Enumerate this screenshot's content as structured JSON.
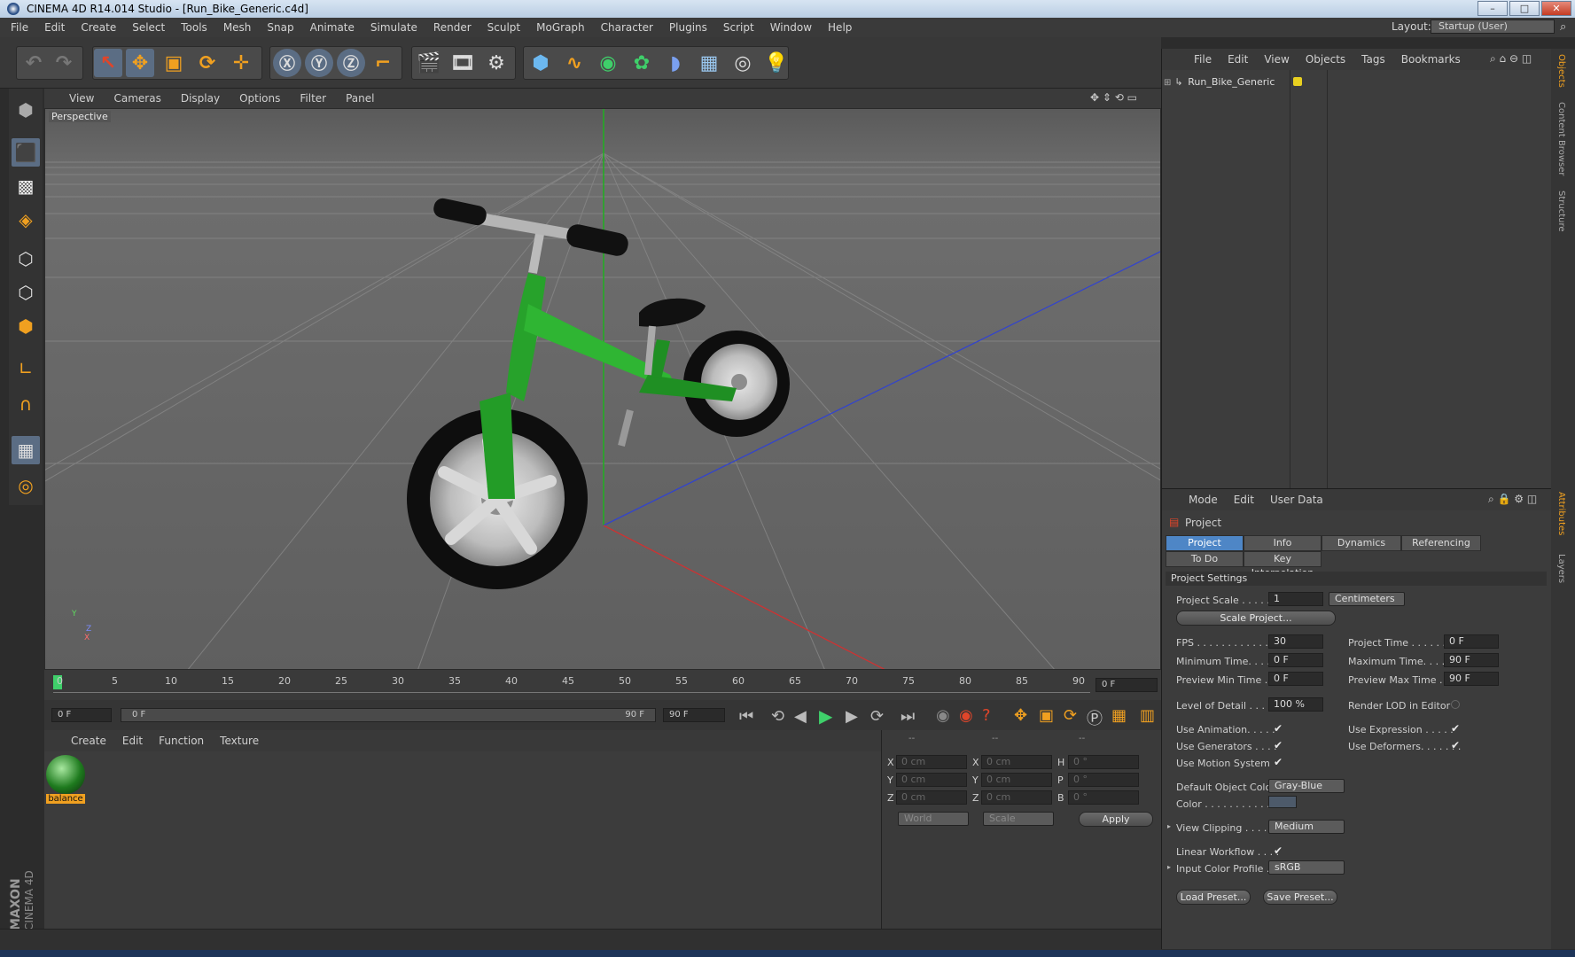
{
  "window": {
    "title": "CINEMA 4D R14.014 Studio - [Run_Bike_Generic.c4d]",
    "controls": [
      "–",
      "□",
      "✕"
    ]
  },
  "menubar": {
    "items": [
      "File",
      "Edit",
      "Create",
      "Select",
      "Tools",
      "Mesh",
      "Snap",
      "Animate",
      "Simulate",
      "Render",
      "Sculpt",
      "MoGraph",
      "Character",
      "Plugins",
      "Script",
      "Window",
      "Help"
    ],
    "layout_label": "Layout:",
    "layout_value": "Startup (User)"
  },
  "viewport": {
    "menu": [
      "View",
      "Cameras",
      "Display",
      "Options",
      "Filter",
      "Panel"
    ],
    "label": "Perspective",
    "axis_y": "Y",
    "axis_z": "Z",
    "axis_x": "X"
  },
  "timeline": {
    "ticks": [
      "0",
      "5",
      "10",
      "15",
      "20",
      "25",
      "30",
      "35",
      "40",
      "45",
      "50",
      "55",
      "60",
      "65",
      "70",
      "75",
      "80",
      "85",
      "90"
    ],
    "current_frame": "0 F",
    "start": "0 F",
    "range_start": "0 F",
    "range_end": "90 F",
    "end": "90 F",
    "progress": 0.0
  },
  "materials": {
    "menu": [
      "Create",
      "Edit",
      "Function",
      "Texture"
    ],
    "items": [
      {
        "name": "balance"
      }
    ]
  },
  "coords": {
    "headers": [
      "--",
      "--",
      "--"
    ],
    "rows": [
      {
        "a": "X",
        "av": "0 cm",
        "b": "X",
        "bv": "0 cm",
        "c": "H",
        "cv": "0 °"
      },
      {
        "a": "Y",
        "av": "0 cm",
        "b": "Y",
        "bv": "0 cm",
        "c": "P",
        "cv": "0 °"
      },
      {
        "a": "Z",
        "av": "0 cm",
        "b": "Z",
        "bv": "0 cm",
        "c": "B",
        "cv": "0 °"
      }
    ],
    "space": "World",
    "mode": "Scale",
    "apply": "Apply"
  },
  "objects": {
    "menu": [
      "File",
      "Edit",
      "View",
      "Objects",
      "Tags",
      "Bookmarks"
    ],
    "items": [
      {
        "name": "Run_Bike_Generic"
      }
    ]
  },
  "attributes": {
    "menu": [
      "Mode",
      "Edit",
      "User Data"
    ],
    "header": "Project",
    "tabs_row1": [
      "Project Settings",
      "Info",
      "Dynamics",
      "Referencing"
    ],
    "tabs_row2": [
      "To Do",
      "Key Interpolation"
    ],
    "section": "Project Settings",
    "project_scale_label": "Project Scale . . . . . .",
    "project_scale_value": "1",
    "project_scale_unit": "Centimeters",
    "scale_project_btn": "Scale Project...",
    "fps_label": "FPS . . . . . . . . . . . . . .",
    "fps_value": "30",
    "project_time_label": "Project Time . . . . . . .",
    "project_time_value": "0 F",
    "min_time_label": "Minimum Time. . . . .",
    "min_time_value": "0 F",
    "max_time_label": "Maximum Time. . . . . .",
    "max_time_value": "90 F",
    "prev_min_label": "Preview Min Time . .",
    "prev_min_value": "0 F",
    "prev_max_label": "Preview Max Time . . .",
    "prev_max_value": "90 F",
    "lod_label": "Level of Detail . . . . .",
    "lod_value": "100 %",
    "render_lod_label": "Render LOD in Editor",
    "use_anim_label": "Use Animation. . . . .",
    "use_expr_label": "Use Expression . . . . .",
    "use_gen_label": "Use Generators . . . .",
    "use_def_label": "Use Deformers. . . . . . .",
    "use_motion_label": "Use Motion System",
    "def_color_label": "Default Object Color",
    "def_color_value": "Gray-Blue",
    "color_label": "Color . . . . . . . . . . . .",
    "view_clip_label": "View Clipping . . . . . .",
    "view_clip_value": "Medium",
    "linear_label": "Linear Workflow . . . .",
    "input_profile_label": "Input Color Profile . .",
    "input_profile_value": "sRGB",
    "load_preset": "Load Preset...",
    "save_preset": "Save Preset..."
  },
  "side_tabs": [
    "Objects",
    "Content Browser",
    "Structure",
    "Attributes",
    "Layers"
  ],
  "brand": {
    "line1": "MAXON",
    "line2": "CINEMA 4D"
  },
  "colors": {
    "accent": "#4e86c6",
    "bike_green": "#2aa02a"
  }
}
